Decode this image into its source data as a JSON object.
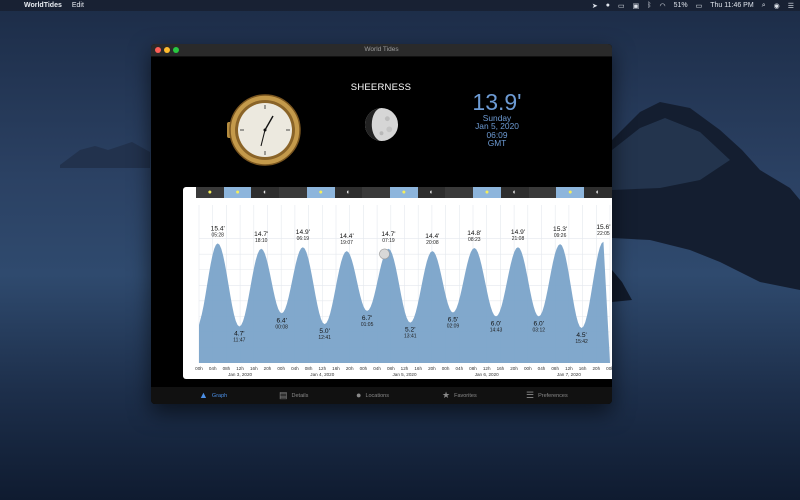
{
  "menubar": {
    "app_name": "WorldTides",
    "menus": [
      "Edit"
    ],
    "battery": "51%",
    "clock": "Thu 11:46 PM"
  },
  "window": {
    "title": "World Tides"
  },
  "header": {
    "station": "SHEERNESS",
    "height": "13.9'",
    "day": "Sunday",
    "date": "Jan 5, 2020",
    "time": "06:09",
    "zone": "GMT"
  },
  "colors": {
    "accent": "#6d9bd4",
    "tide_fill": "#7aa3c9",
    "tab_active": "#4b8fe6",
    "strip_day": "#8db5dc",
    "strip_night": "#2e2e2e"
  },
  "moon_strip": [
    {
      "icon": "sun-icon",
      "day": false
    },
    {
      "icon": "sun-icon",
      "day": true
    },
    {
      "icon": "moon-icon",
      "day": false
    },
    {
      "icon": "",
      "day": false
    },
    {
      "icon": "sun-icon",
      "day": true
    },
    {
      "icon": "moon-icon",
      "day": false
    },
    {
      "icon": "",
      "day": false
    },
    {
      "icon": "sun-icon",
      "day": true
    },
    {
      "icon": "moon-icon",
      "day": false
    },
    {
      "icon": "",
      "day": false
    },
    {
      "icon": "sun-icon",
      "day": true
    },
    {
      "icon": "moon-icon",
      "day": false
    },
    {
      "icon": "",
      "day": false
    },
    {
      "icon": "sun-icon",
      "day": true
    },
    {
      "icon": "moon-icon",
      "day": false
    }
  ],
  "chart_data": {
    "type": "area",
    "tides": [
      {
        "type": "high",
        "height": "15.4'",
        "time": "05:28",
        "h": 15.4
      },
      {
        "type": "low",
        "height": "4.7'",
        "time": "11:47",
        "h": 4.7
      },
      {
        "type": "high",
        "height": "14.7'",
        "time": "18:10",
        "h": 14.7
      },
      {
        "type": "low",
        "height": "6.4'",
        "time": "00:08",
        "h": 6.4
      },
      {
        "type": "high",
        "height": "14.9'",
        "time": "06:19",
        "h": 14.9
      },
      {
        "type": "low",
        "height": "5.0'",
        "time": "12:41",
        "h": 5.0
      },
      {
        "type": "high",
        "height": "14.4'",
        "time": "19:07",
        "h": 14.4
      },
      {
        "type": "low",
        "height": "6.7'",
        "time": "01:05",
        "h": 6.7
      },
      {
        "type": "high",
        "height": "14.7'",
        "time": "07:19",
        "h": 14.7
      },
      {
        "type": "low",
        "height": "5.2'",
        "time": "13:41",
        "h": 5.2
      },
      {
        "type": "high",
        "height": "14.4'",
        "time": "20:08",
        "h": 14.4
      },
      {
        "type": "low",
        "height": "6.5'",
        "time": "02:09",
        "h": 6.5
      },
      {
        "type": "high",
        "height": "14.8'",
        "time": "08:23",
        "h": 14.8
      },
      {
        "type": "low",
        "height": "6.0'",
        "time": "14:43",
        "h": 6.0
      },
      {
        "type": "high",
        "height": "14.9'",
        "time": "21:08",
        "h": 14.9
      },
      {
        "type": "low",
        "height": "6.0'",
        "time": "03:12",
        "h": 6.0
      },
      {
        "type": "high",
        "height": "15.3'",
        "time": "09:26",
        "h": 15.3
      },
      {
        "type": "low",
        "height": "4.5'",
        "time": "15:42",
        "h": 4.5
      },
      {
        "type": "high",
        "height": "15.6'",
        "time": "22:05",
        "h": 15.6
      }
    ],
    "hour_ticks": [
      "00h",
      "04h",
      "08h",
      "12h",
      "16h",
      "20h",
      "00h",
      "04h",
      "08h",
      "12h",
      "16h",
      "20h",
      "00h",
      "04h",
      "08h",
      "12h",
      "16h",
      "20h",
      "00h",
      "04h",
      "08h",
      "12h",
      "16h",
      "20h",
      "00h",
      "04h",
      "08h",
      "12h",
      "16h",
      "20h",
      "00h"
    ],
    "day_labels": [
      "Jan 3, 2020",
      "Jan 4, 2020",
      "Jan 5, 2020",
      "Jan 6, 2020",
      "Jan 7, 2020"
    ],
    "grid": true
  },
  "tabs": [
    {
      "label": "Graph",
      "icon": "graph-icon",
      "active": true
    },
    {
      "label": "Details",
      "icon": "document-icon",
      "active": false
    },
    {
      "label": "Locations",
      "icon": "globe-icon",
      "active": false
    },
    {
      "label": "Favorites",
      "icon": "star-icon",
      "active": false
    },
    {
      "label": "Preferences",
      "icon": "list-icon",
      "active": false
    }
  ]
}
